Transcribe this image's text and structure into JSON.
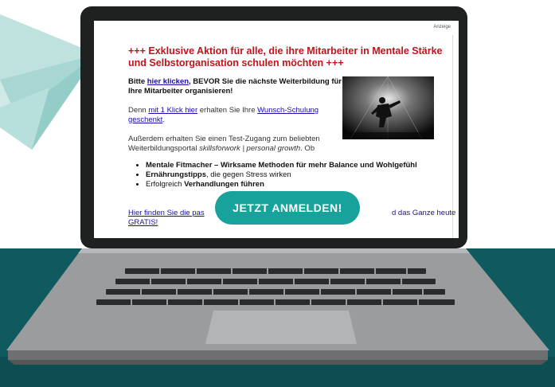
{
  "colors": {
    "desk": "#0f5a5e",
    "accent": "#17a39b",
    "headline": "#c0141c",
    "link": "#1a0dab"
  },
  "screen": {
    "ad_label": "Anzeige",
    "headline": "+++ Exklusive Aktion für alle, die ihre Mitarbeiter in Mentale Stärke und Selbstorganisation schulen möchten +++",
    "intro": {
      "prefix": "Bitte ",
      "link": "hier klicken",
      "suffix": ", BEVOR Sie die nächste Weiterbildung für Ihre Mitarbeiter organisieren!"
    },
    "p1": {
      "prefix": "Denn ",
      "link1": "mit 1 Klick hier",
      "middle": " erhalten Sie Ihre ",
      "link2": "Wunsch-Schulung geschenkt",
      "suffix": "."
    },
    "p2": {
      "prefix": "Außerdem erhalten Sie einen Test-Zugang zum beliebten Weiterbildungsportal ",
      "italic": "skillsforwork | personal growth",
      "suffix": ". Ob"
    },
    "bullets": [
      {
        "bold": "Mentale Fitmacher – Wirksame Methoden für mehr Balance und Wohlgefühl",
        "rest": ""
      },
      {
        "bold": "Ernährungstipps",
        "rest": ", die gegen Stress wirken"
      },
      {
        "pre": "Erfolgreich ",
        "bold": "Verhandlungen führen"
      }
    ],
    "cta_link_left": "Hier finden Sie die pas",
    "cta_link_right": "d das Ganze heute",
    "cta_link_line2": "GRATIS!"
  },
  "cta_button": "JETZT ANMELDEN!",
  "icons": {
    "envelope": "envelope-icon",
    "laptop": "laptop-icon"
  }
}
